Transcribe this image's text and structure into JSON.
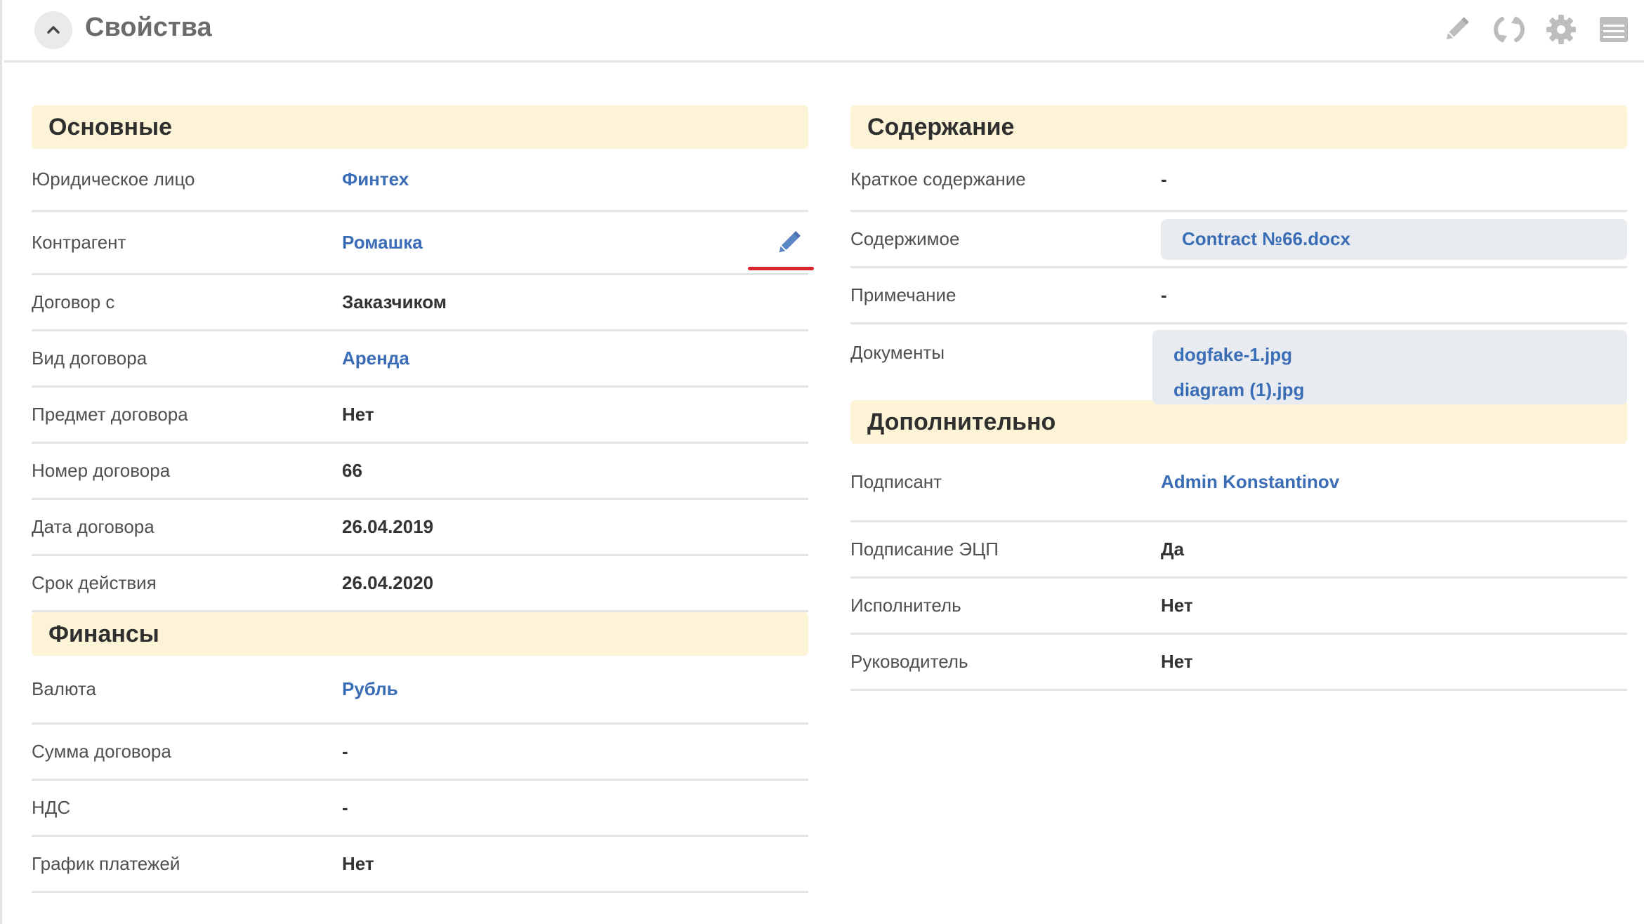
{
  "header": {
    "title": "Свойства"
  },
  "main": {
    "title": "Основные",
    "rows": [
      {
        "label": "Юридическое лицо",
        "value": "Финтех"
      },
      {
        "label": "Контрагент",
        "value": "Ромашка"
      },
      {
        "label": "Договор с",
        "value": "Заказчиком"
      },
      {
        "label": "Вид договора",
        "value": "Аренда"
      },
      {
        "label": "Предмет договора",
        "value": "Нет"
      },
      {
        "label": "Номер договора",
        "value": "66"
      },
      {
        "label": "Дата договора",
        "value": "26.04.2019"
      },
      {
        "label": "Срок действия",
        "value": "26.04.2020"
      }
    ]
  },
  "finance": {
    "title": "Финансы",
    "rows": [
      {
        "label": "Валюта",
        "value": "Рубль"
      },
      {
        "label": "Сумма договора",
        "value": "-"
      },
      {
        "label": "НДС",
        "value": "-"
      },
      {
        "label": "График платежей",
        "value": "Нет"
      }
    ]
  },
  "content": {
    "title": "Содержание",
    "summary": {
      "label": "Краткое содержание",
      "value": "-"
    },
    "file": {
      "label": "Содержимое",
      "value": "Contract №66.docx"
    },
    "note": {
      "label": "Примечание",
      "value": "-"
    },
    "documents": {
      "label": "Документы",
      "files": [
        "dogfake-1.jpg",
        "diagram (1).jpg"
      ]
    }
  },
  "extra": {
    "title": "Дополнительно",
    "rows": [
      {
        "label": "Подписант",
        "value": "Admin Konstantinov"
      },
      {
        "label": "Подписание ЭЦП",
        "value": "Да"
      },
      {
        "label": "Исполнитель",
        "value": "Нет"
      },
      {
        "label": "Руководитель",
        "value": "Нет"
      }
    ]
  },
  "colors": {
    "section_bg": "#fdf3d6",
    "link": "#3a6db5",
    "file_bg": "#e8ecf0",
    "highlight": "#d9262c"
  },
  "icons": [
    "chevron-up-icon",
    "pencil-icon",
    "refresh-icon",
    "gear-icon",
    "list-icon"
  ]
}
